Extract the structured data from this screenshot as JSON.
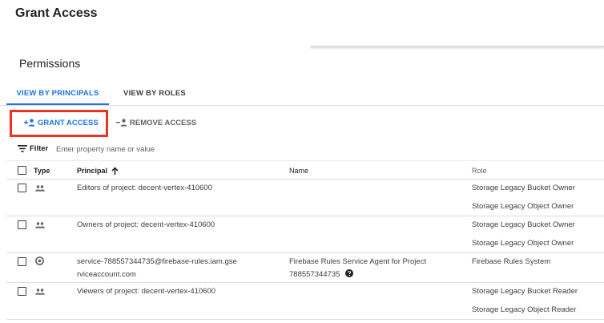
{
  "header": {
    "title": "Grant Access"
  },
  "section": {
    "title": "Permissions"
  },
  "tabs": [
    {
      "label": "VIEW BY PRINCIPALS",
      "active": true
    },
    {
      "label": "VIEW BY ROLES",
      "active": false
    }
  ],
  "actions": {
    "grant_label": "GRANT ACCESS",
    "remove_label": "REMOVE ACCESS",
    "highlight_color": "#ea3323"
  },
  "filter": {
    "label": "Filter",
    "placeholder": "Enter property name or value"
  },
  "table": {
    "headers": {
      "type": "Type",
      "principal": "Principal",
      "name": "Name",
      "role": "Role"
    },
    "rows": [
      {
        "type_icon": "group-icon",
        "principal": "Editors of project: decent-vertex-410600",
        "name": "",
        "roles": [
          "Storage Legacy Bucket Owner",
          "Storage Legacy Object Owner"
        ]
      },
      {
        "type_icon": "group-icon",
        "principal": "Owners of project: decent-vertex-410600",
        "name": "",
        "roles": [
          "Storage Legacy Bucket Owner",
          "Storage Legacy Object Owner"
        ]
      },
      {
        "type_icon": "service-account-icon",
        "principal": "service-788557344735@firebase-rules.iam.gserviceaccount.com",
        "name": "Firebase Rules Service Agent for Project 788557344735",
        "roles": [
          "Firebase Rules System"
        ]
      },
      {
        "type_icon": "group-icon",
        "principal": "Viewers of project: decent-vertex-410600",
        "name": "",
        "roles": [
          "Storage Legacy Bucket Reader",
          "Storage Legacy Object Reader"
        ]
      }
    ]
  },
  "colors": {
    "accent": "#1a73e8",
    "text": "#3c4043",
    "divider": "#dadce0"
  }
}
